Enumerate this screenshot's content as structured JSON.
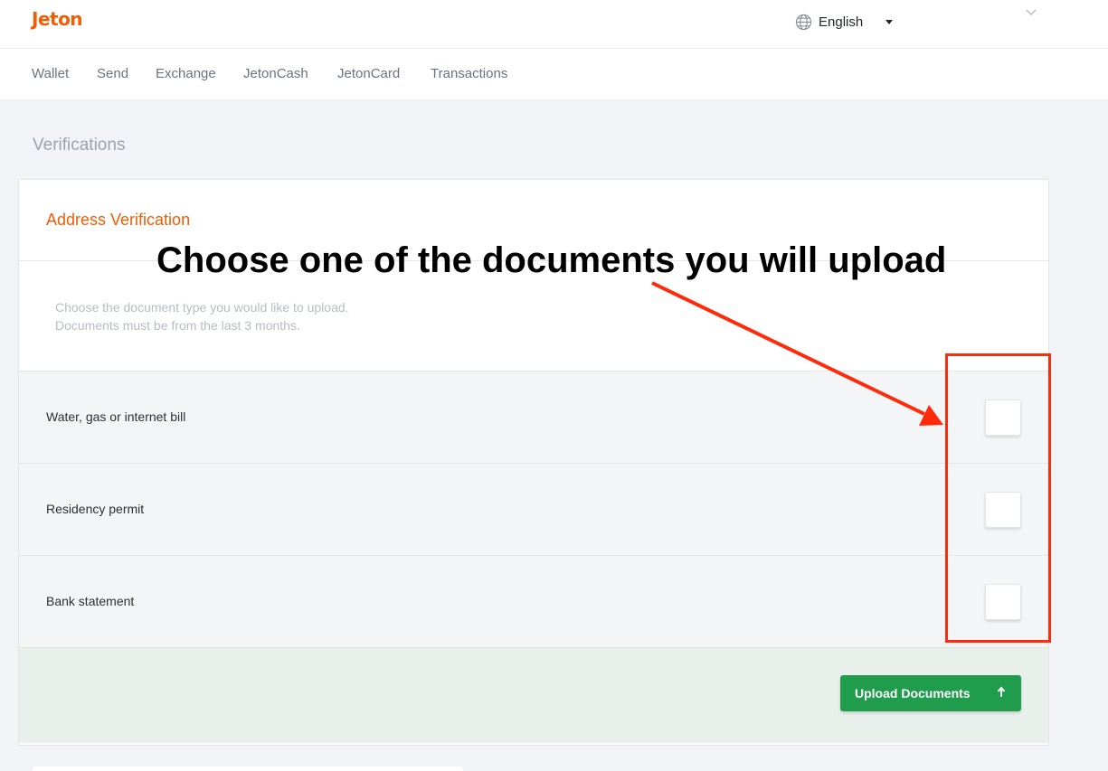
{
  "header": {
    "logo": "Jeton",
    "language": {
      "label": "English",
      "icon": "globe-icon"
    }
  },
  "nav": {
    "items": [
      {
        "label": "Wallet"
      },
      {
        "label": "Send"
      },
      {
        "label": "Exchange"
      },
      {
        "label": "JetonCash"
      },
      {
        "label": "JetonCard"
      },
      {
        "label": "Transactions"
      }
    ]
  },
  "page": {
    "title": "Verifications"
  },
  "card": {
    "title": "Address Verification",
    "description_line1": "Choose the document type you would like to upload.",
    "description_line2": "Documents must be from the last 3 months.",
    "documents": [
      {
        "label": "Water, gas or internet bill",
        "checked": false
      },
      {
        "label": "Residency permit",
        "checked": false
      },
      {
        "label": "Bank statement",
        "checked": false
      }
    ],
    "upload_button": "Upload Documents"
  },
  "annotation": {
    "text": "Choose one of the documents you will upload",
    "color": "#ff2a0a"
  },
  "colors": {
    "brand": "#f25c05",
    "button": "#1f9d4c",
    "annotation": "#ff2a0a"
  }
}
